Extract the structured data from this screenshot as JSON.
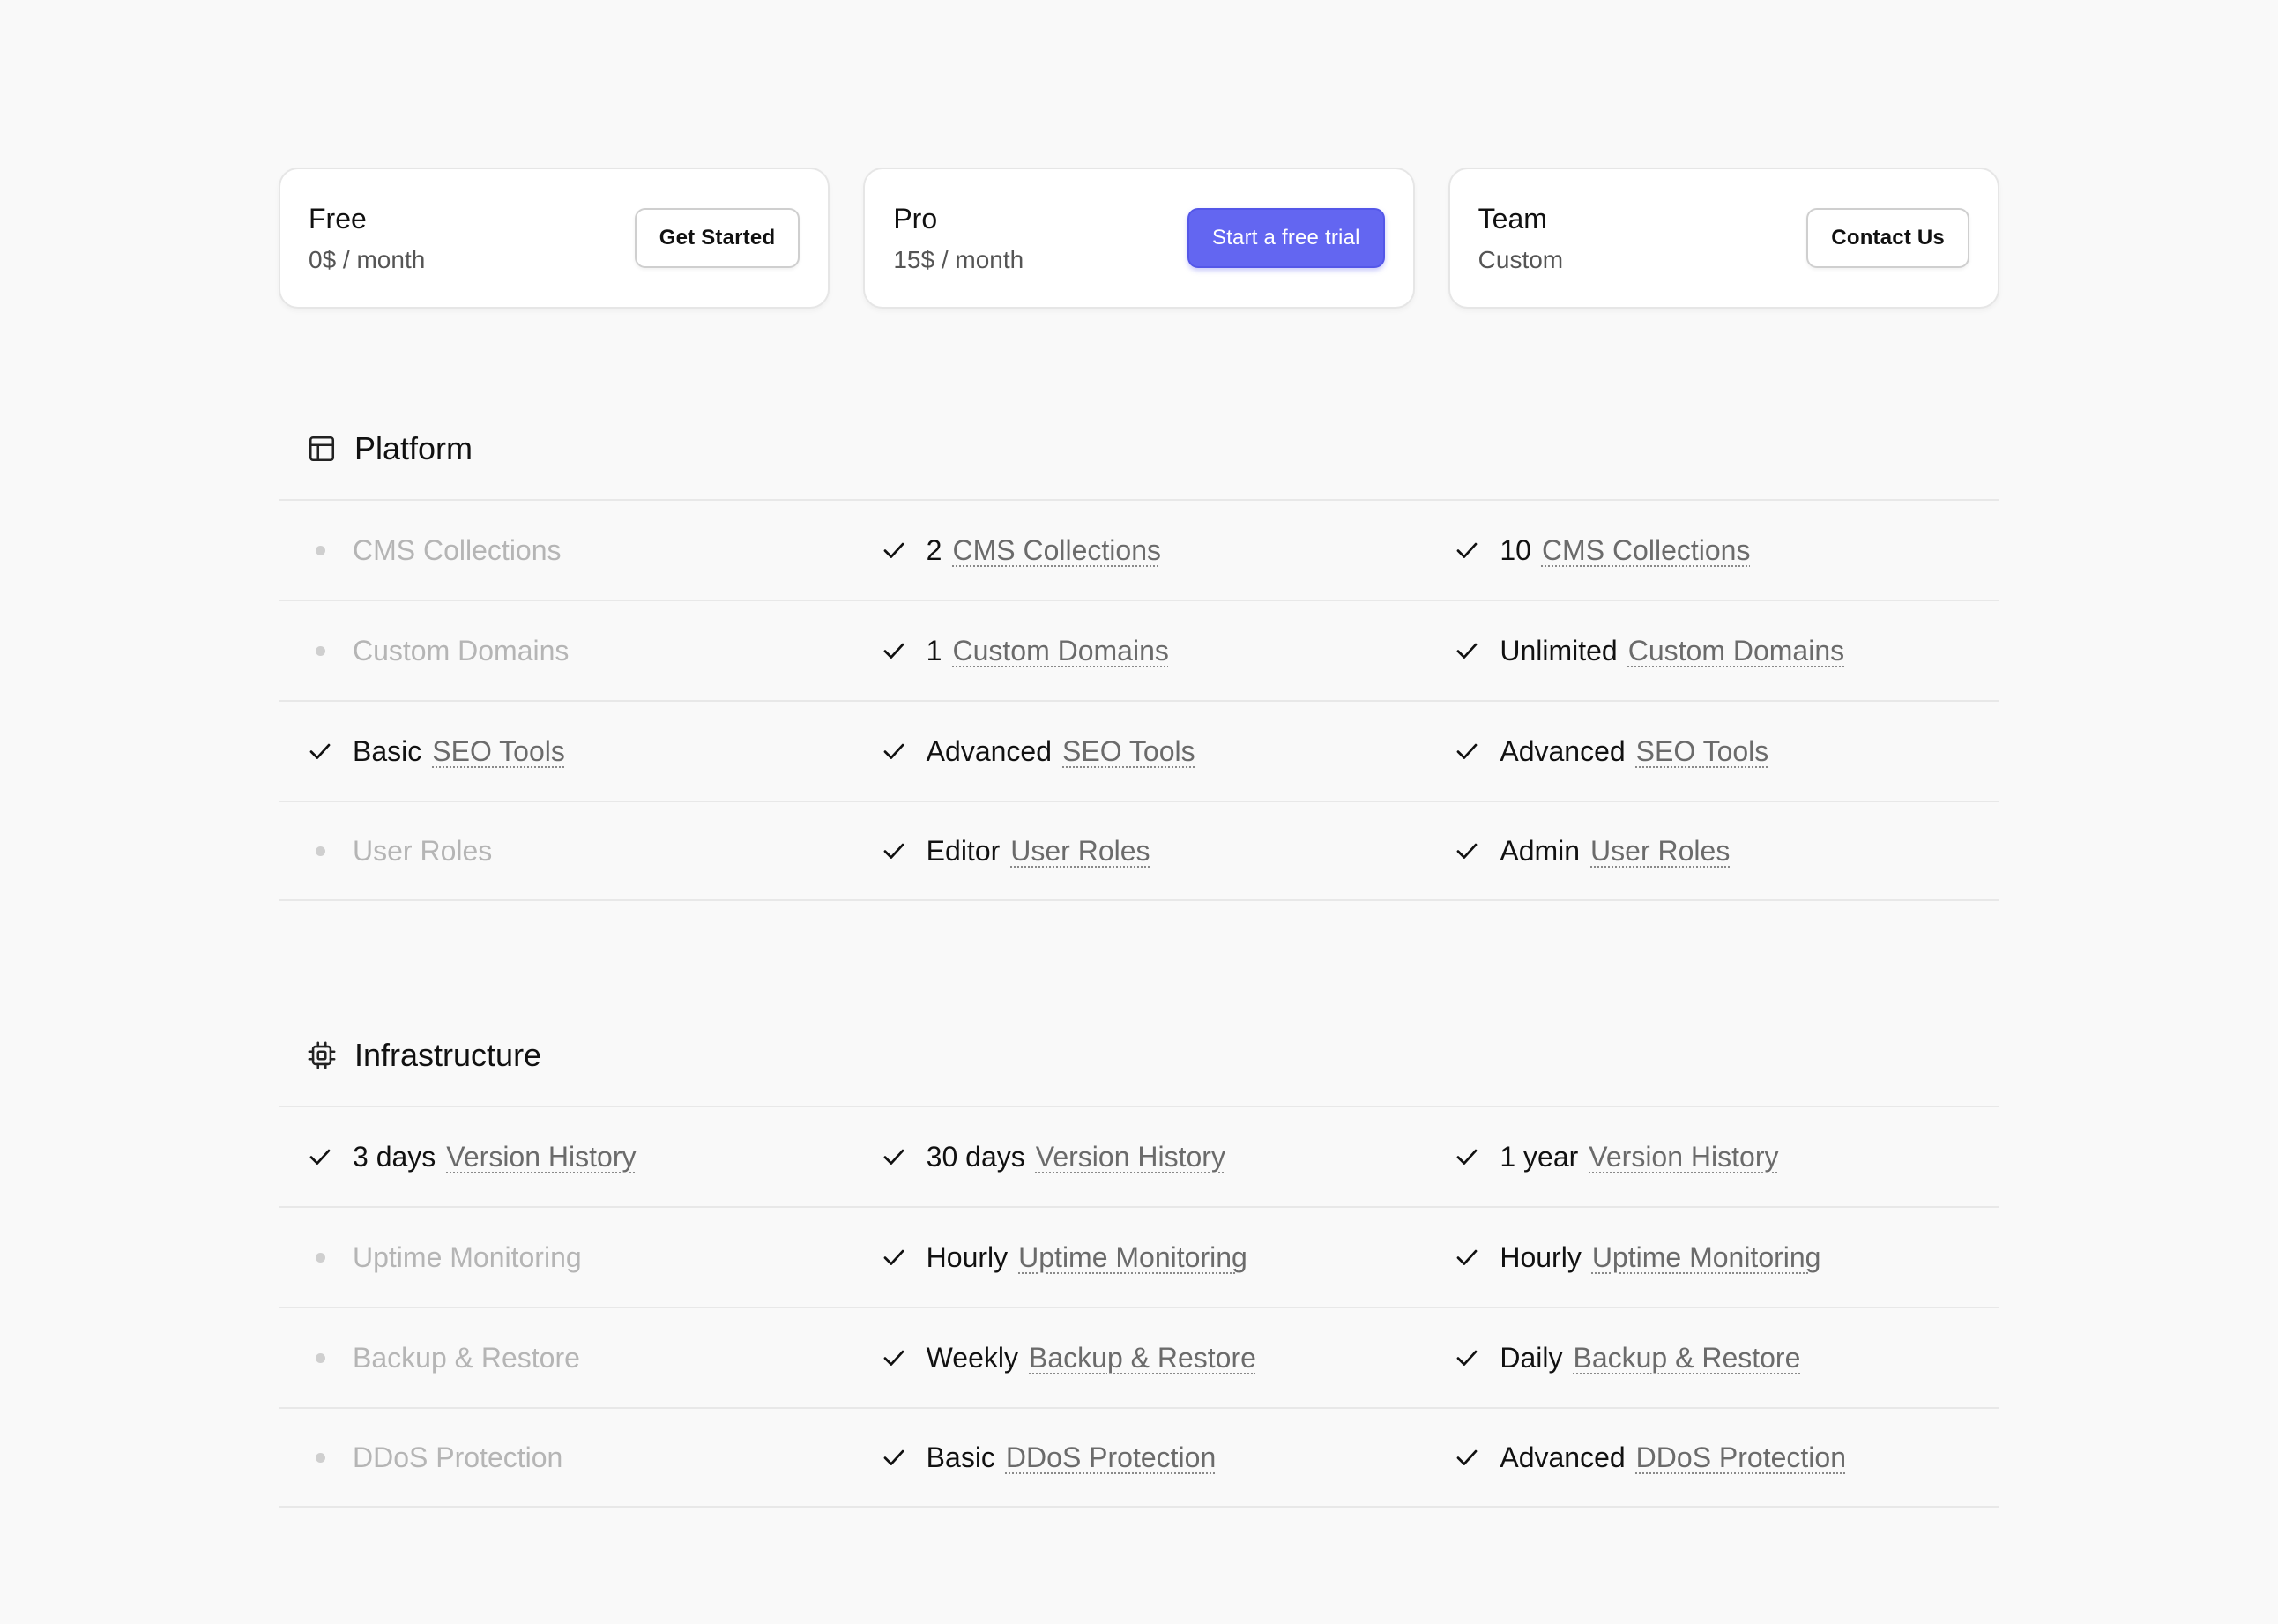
{
  "plans": [
    {
      "name": "Free",
      "price": "0$ / month",
      "button": "Get Started"
    },
    {
      "name": "Pro",
      "price": "15$ / month",
      "button": "Start a free trial"
    },
    {
      "name": "Team",
      "price": "Custom",
      "button": "Contact Us"
    }
  ],
  "sections": [
    {
      "title": "Platform",
      "icon": "layout-icon",
      "rows": [
        {
          "feature": "CMS Collections",
          "cells": [
            {
              "included": false,
              "qualifier": ""
            },
            {
              "included": true,
              "qualifier": "2"
            },
            {
              "included": true,
              "qualifier": "10"
            }
          ]
        },
        {
          "feature": "Custom Domains",
          "cells": [
            {
              "included": false,
              "qualifier": ""
            },
            {
              "included": true,
              "qualifier": "1"
            },
            {
              "included": true,
              "qualifier": "Unlimited"
            }
          ]
        },
        {
          "feature": "SEO Tools",
          "cells": [
            {
              "included": true,
              "qualifier": "Basic"
            },
            {
              "included": true,
              "qualifier": "Advanced"
            },
            {
              "included": true,
              "qualifier": "Advanced"
            }
          ]
        },
        {
          "feature": "User Roles",
          "cells": [
            {
              "included": false,
              "qualifier": ""
            },
            {
              "included": true,
              "qualifier": "Editor"
            },
            {
              "included": true,
              "qualifier": "Admin"
            }
          ]
        }
      ]
    },
    {
      "title": "Infrastructure",
      "icon": "cpu-icon",
      "rows": [
        {
          "feature": "Version History",
          "cells": [
            {
              "included": true,
              "qualifier": "3 days"
            },
            {
              "included": true,
              "qualifier": "30 days"
            },
            {
              "included": true,
              "qualifier": "1 year"
            }
          ]
        },
        {
          "feature": "Uptime Monitoring",
          "cells": [
            {
              "included": false,
              "qualifier": ""
            },
            {
              "included": true,
              "qualifier": "Hourly"
            },
            {
              "included": true,
              "qualifier": "Hourly"
            }
          ]
        },
        {
          "feature": "Backup & Restore",
          "cells": [
            {
              "included": false,
              "qualifier": ""
            },
            {
              "included": true,
              "qualifier": "Weekly"
            },
            {
              "included": true,
              "qualifier": "Daily"
            }
          ]
        },
        {
          "feature": "DDoS Protection",
          "cells": [
            {
              "included": false,
              "qualifier": ""
            },
            {
              "included": true,
              "qualifier": "Basic"
            },
            {
              "included": true,
              "qualifier": "Advanced"
            }
          ]
        }
      ]
    }
  ],
  "colors": {
    "accent": "#6366f1",
    "background": "#f9f9f9",
    "text": "#111111",
    "muted": "#b5b5b5"
  }
}
